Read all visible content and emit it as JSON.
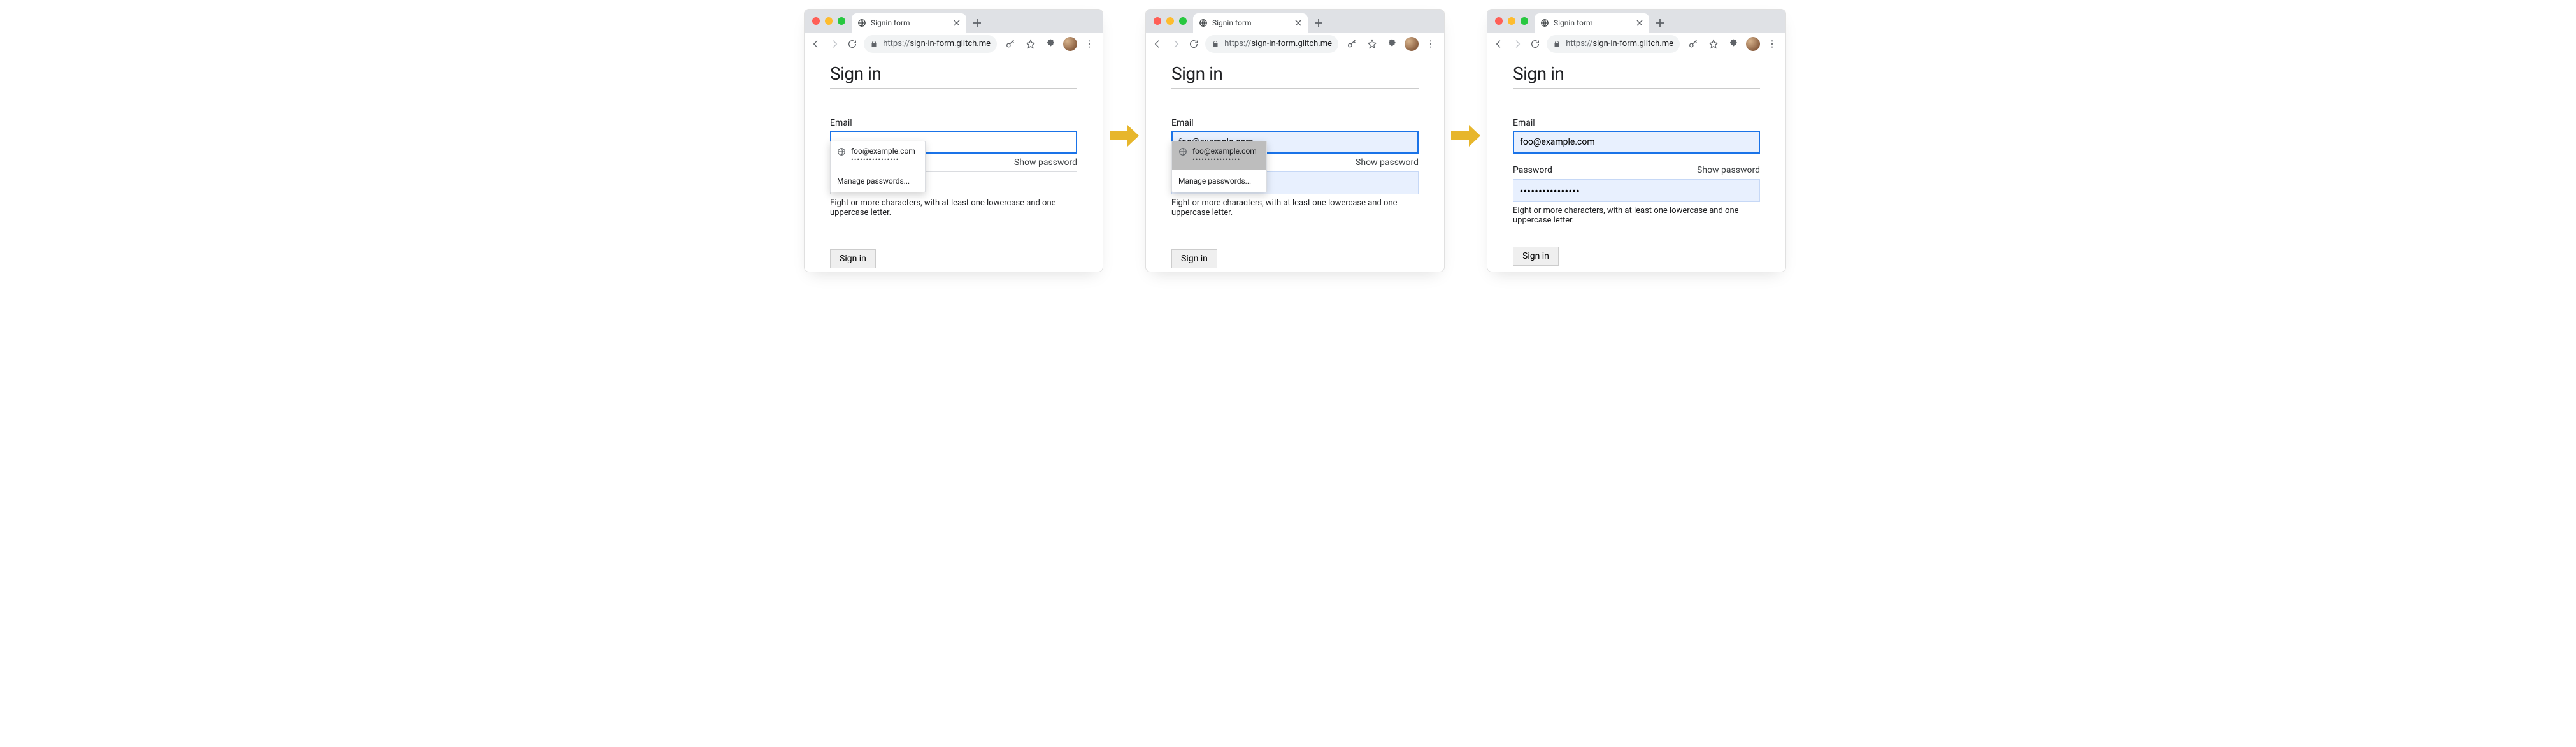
{
  "browser": {
    "tab_title": "Signin form",
    "url_scheme": "https://",
    "url_host": "sign-in-form.glitch.me"
  },
  "page": {
    "heading": "Sign in",
    "email_label": "Email",
    "password_label": "Password",
    "show_password": "Show password",
    "hint": "Eight or more characters, with at least one lowercase and one uppercase letter.",
    "signin_button": "Sign in"
  },
  "autofill": {
    "username": "foo@example.com",
    "masked_password": "••••••••••••••••",
    "manage": "Manage passwords..."
  },
  "state2": {
    "email_value": "foo@example.com"
  },
  "state3": {
    "email_value": "foo@example.com",
    "password_value": "••••••••••••••••"
  }
}
